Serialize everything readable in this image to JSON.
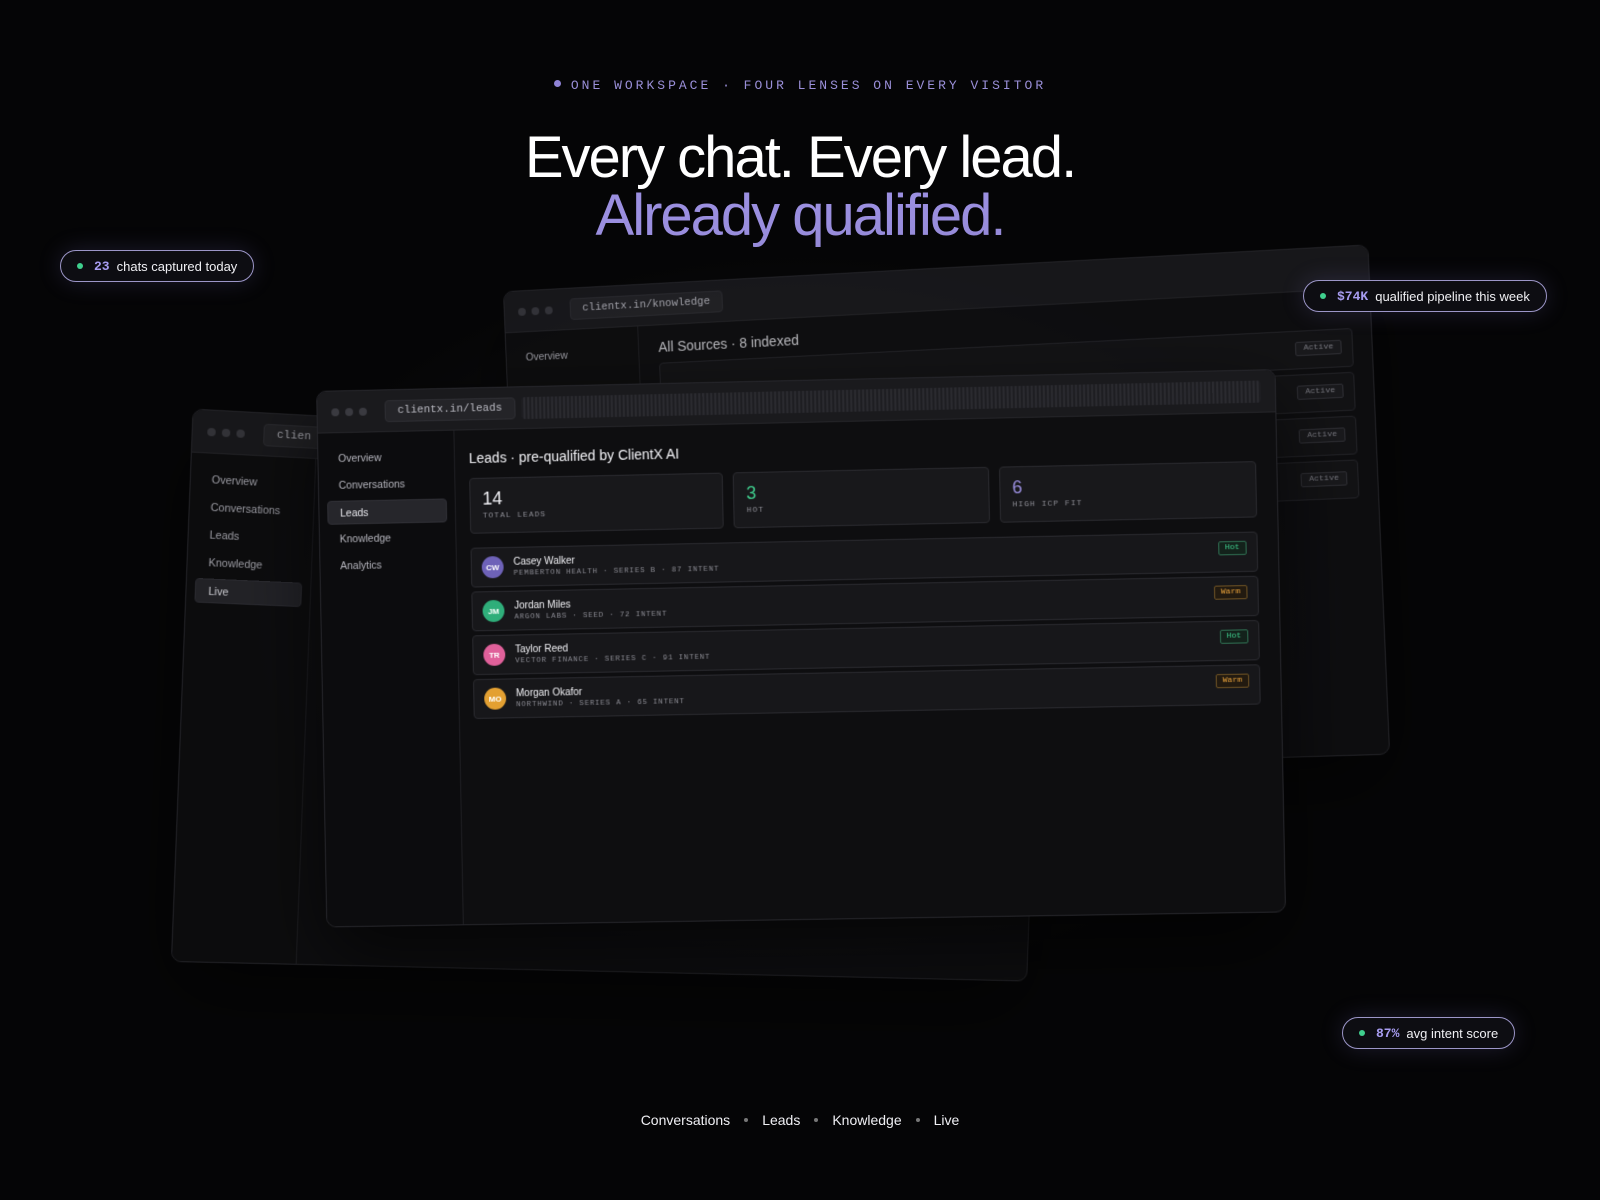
{
  "hero": {
    "eyebrow": "ONE WORKSPACE · FOUR LENSES ON EVERY VISITOR",
    "headline": "Every chat. Every lead.",
    "subheadline": "Already qualified."
  },
  "pills": {
    "chats": {
      "value": "23",
      "label": "chats captured today"
    },
    "pipeline": {
      "value": "$74K",
      "label": "qualified pipeline this week"
    },
    "intent": {
      "value": "87%",
      "label": "avg intent score"
    }
  },
  "live_window": {
    "url": "clien",
    "nav": [
      "Overview",
      "Conversations",
      "Leads",
      "Knowledge",
      "Live"
    ]
  },
  "knowledge_window": {
    "url": "clientx.in/knowledge",
    "nav_first": "Overview",
    "title": "All Sources · 8 indexed",
    "badge": "Active"
  },
  "leads_window": {
    "url": "clientx.in/leads",
    "nav": [
      "Overview",
      "Conversations",
      "Leads",
      "Knowledge",
      "Analytics"
    ],
    "title": "Leads · pre-qualified by ClientX AI",
    "stats": [
      {
        "value": "14",
        "label": "TOTAL LEADS"
      },
      {
        "value": "3",
        "label": "HOT"
      },
      {
        "value": "6",
        "label": "HIGH ICP FIT"
      }
    ],
    "leads": [
      {
        "initials": "CW",
        "name": "Casey Walker",
        "meta": "PEMBERTON HEALTH · SERIES B · 87 INTENT",
        "badge": "Hot",
        "color": "#6e62b8"
      },
      {
        "initials": "JM",
        "name": "Jordan Miles",
        "meta": "ARGON LABS · SEED · 72 INTENT",
        "badge": "Warm",
        "color": "#2fae7a"
      },
      {
        "initials": "TR",
        "name": "Taylor Reed",
        "meta": "VECTOR FINANCE · SERIES C · 91 INTENT",
        "badge": "Hot",
        "color": "#e0609a"
      },
      {
        "initials": "MO",
        "name": "Morgan Okafor",
        "meta": "NORTHWIND · SERIES A · 65 INTENT",
        "badge": "Warm",
        "color": "#e3a032"
      }
    ]
  },
  "footer_nav": [
    "Conversations",
    "Leads",
    "Knowledge",
    "Live"
  ]
}
